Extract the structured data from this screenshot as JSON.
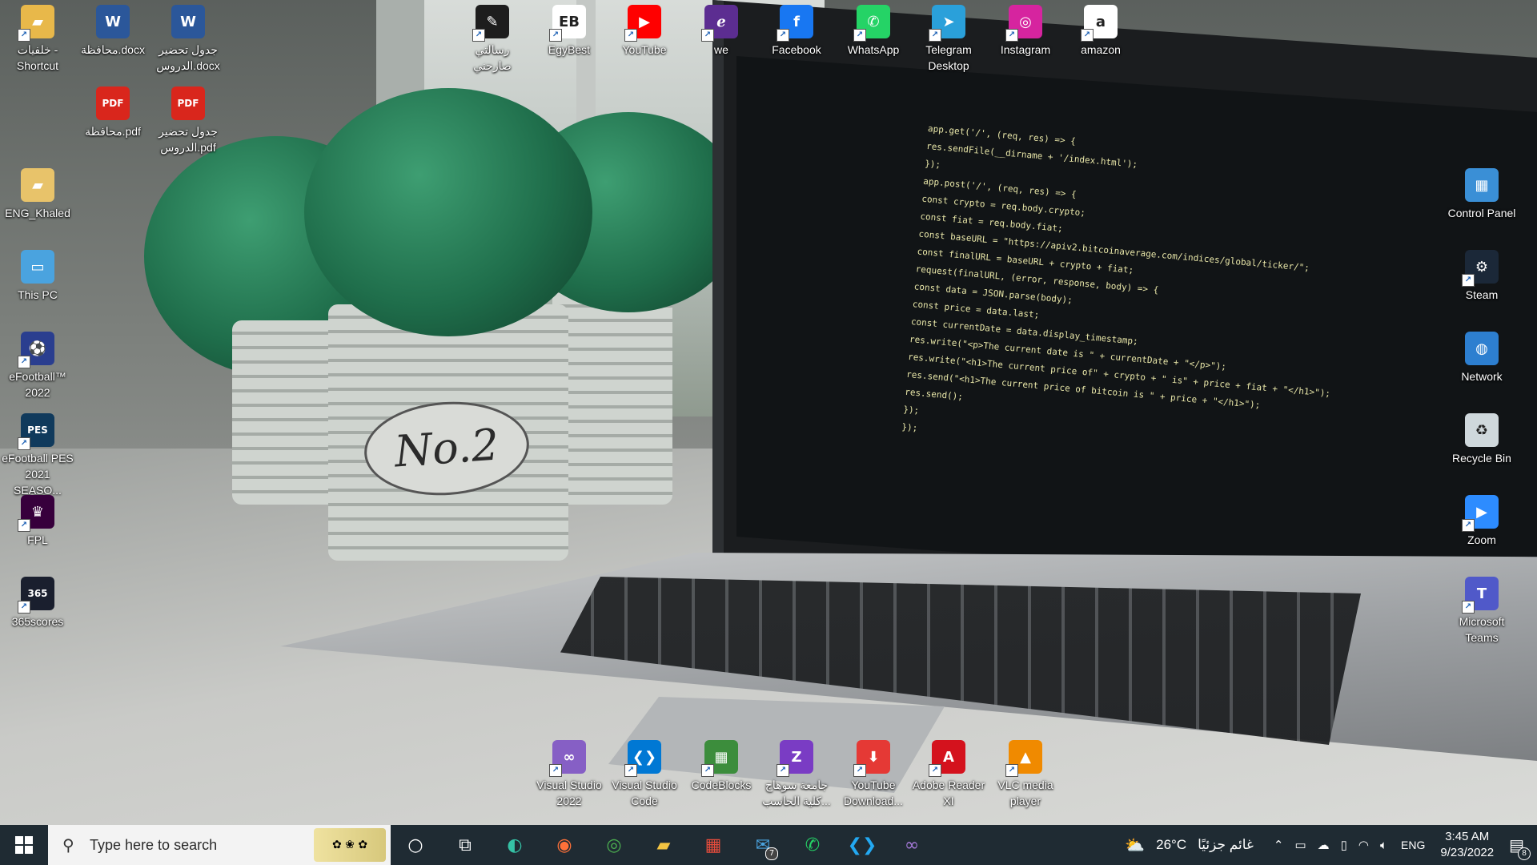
{
  "wallpaper": {
    "pot_label": "No.2",
    "code_lines": [
      "app.get('/', (req, res) => {",
      "  res.sendFile(__dirname + '/index.html');",
      "});",
      "",
      "app.post('/', (req, res) => {",
      "  const crypto = req.body.crypto;",
      "  const fiat = req.body.fiat;",
      "",
      "  const baseURL = \"https://apiv2.bitcoinaverage.com/indices/global/ticker/\";",
      "  const finalURL = baseURL + crypto + fiat;",
      "  request(finalURL, (error, response, body) => {",
      "  const data = JSON.parse(body);",
      "  const price = data.last;",
      "",
      "  const currentDate = data.display_timestamp;",
      "  res.write(\"<p>The current date is \" + currentDate + \"</p>\");",
      "  res.write(\"<h1>The current price of\" + crypto + \" is\" + price + fiat + \"</h1>\");",
      "",
      "  res.send(\"<h1>The current price of bitcoin is \" + price + \"</h1>\");",
      "  res.send();",
      "  });",
      "});"
    ]
  },
  "desktop": {
    "left_icons": [
      {
        "label": "خلفيات - Shortcut",
        "icon": "folder-shortcut-icon",
        "color": "#e8b84a"
      },
      {
        "label": "ENG_Khaled",
        "icon": "folder-user-icon",
        "color": "#e8c36a"
      },
      {
        "label": "This PC",
        "icon": "computer-icon",
        "color": "#4aa3df"
      },
      {
        "label": "eFootball™ 2022",
        "icon": "efootball-icon",
        "color": "#2a3e8f"
      },
      {
        "label": "eFootball PES 2021 SEASO...",
        "icon": "pes-icon",
        "color": "#103a5c"
      },
      {
        "label": "FPL",
        "icon": "premier-league-icon",
        "color": "#37003c"
      },
      {
        "label": "365scores",
        "icon": "365scores-icon",
        "color": "#1a1f2e"
      }
    ],
    "doc_icons": [
      {
        "label": "محافظة.docx",
        "icon": "word-doc-icon",
        "color": "#2b579a"
      },
      {
        "label": "جدول تحضير الدروس.docx",
        "icon": "word-doc-icon",
        "color": "#2b579a"
      },
      {
        "label": "محافظة.pdf",
        "icon": "pdf-icon",
        "color": "#d9261c"
      },
      {
        "label": "جدول تحضير الدروس.pdf",
        "icon": "pdf-icon",
        "color": "#d9261c"
      }
    ],
    "top_icons": [
      {
        "label": "رسالتي صارحني",
        "icon": "saraha-icon",
        "color": "#1d1d1d"
      },
      {
        "label": "EgyBest",
        "icon": "egybest-icon",
        "color": "#ffffff"
      },
      {
        "label": "YouTube",
        "icon": "youtube-icon",
        "color": "#ff0000"
      },
      {
        "label": "we",
        "icon": "we-icon",
        "color": "#5c2d91"
      },
      {
        "label": "Facebook",
        "icon": "facebook-icon",
        "color": "#1877f2"
      },
      {
        "label": "WhatsApp",
        "icon": "whatsapp-icon",
        "color": "#25d366"
      },
      {
        "label": "Telegram Desktop",
        "icon": "telegram-icon",
        "color": "#2aa0da"
      },
      {
        "label": "Instagram",
        "icon": "instagram-icon",
        "color": "#d6249f"
      },
      {
        "label": "amazon",
        "icon": "amazon-icon",
        "color": "#ffffff"
      }
    ],
    "right_icons": [
      {
        "label": "Control Panel",
        "icon": "control-panel-icon",
        "color": "#3a8fd6"
      },
      {
        "label": "Steam",
        "icon": "steam-icon",
        "color": "#1b2838"
      },
      {
        "label": "Network",
        "icon": "network-icon",
        "color": "#2d7fd0"
      },
      {
        "label": "Recycle Bin",
        "icon": "recycle-bin-icon",
        "color": "#cfd8dc"
      },
      {
        "label": "Zoom",
        "icon": "zoom-icon",
        "color": "#2d8cff"
      },
      {
        "label": "Microsoft Teams",
        "icon": "teams-icon",
        "color": "#5059c9"
      }
    ],
    "bottom_icons": [
      {
        "label": "Visual Studio 2022",
        "icon": "visual-studio-icon",
        "color": "#865fc5"
      },
      {
        "label": "Visual Studio Code",
        "icon": "vscode-icon",
        "color": "#0078d4"
      },
      {
        "label": "CodeBlocks",
        "icon": "codeblocks-icon",
        "color": "#3c8d3c"
      },
      {
        "label": "جامعة سوهاج كلية الحاسب...",
        "icon": "sohag-university-icon",
        "color": "#7a3cc4"
      },
      {
        "label": "YouTube Download...",
        "icon": "youtube-downloader-icon",
        "color": "#e53935"
      },
      {
        "label": "Adobe Reader XI",
        "icon": "adobe-reader-icon",
        "color": "#d4121d"
      },
      {
        "label": "VLC media player",
        "icon": "vlc-icon",
        "color": "#f08a00"
      }
    ]
  },
  "taskbar": {
    "search_placeholder": "Type here to search",
    "pinned": [
      {
        "name": "cortana",
        "icon": "cortana-circle-icon"
      },
      {
        "name": "task-view",
        "icon": "task-view-icon"
      },
      {
        "name": "edge",
        "icon": "edge-icon"
      },
      {
        "name": "firefox",
        "icon": "firefox-icon"
      },
      {
        "name": "chrome",
        "icon": "chrome-icon"
      },
      {
        "name": "file-explorer",
        "icon": "folder-icon"
      },
      {
        "name": "store",
        "icon": "store-icon"
      },
      {
        "name": "mail",
        "icon": "mail-icon",
        "badge": "7"
      },
      {
        "name": "whatsapp",
        "icon": "whatsapp-icon"
      },
      {
        "name": "vscode",
        "icon": "vscode-icon"
      },
      {
        "name": "visual-studio",
        "icon": "visual-studio-icon"
      }
    ],
    "weather": {
      "temp": "26°C",
      "desc": "غائم جزئيًا"
    },
    "language": "ENG",
    "time": "3:45 AM",
    "date": "9/23/2022",
    "notification_count": "8"
  }
}
